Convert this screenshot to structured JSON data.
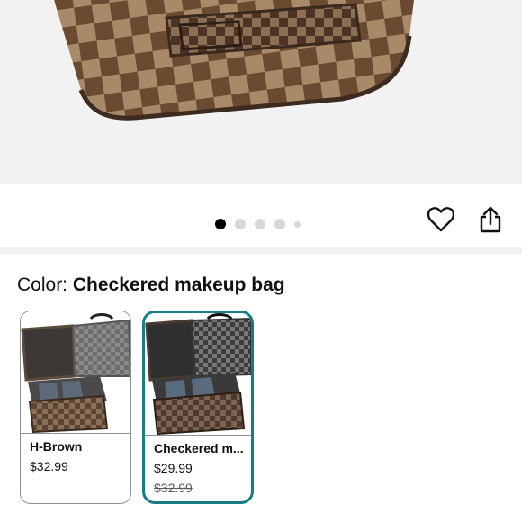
{
  "hero": {
    "image_alt": "checkered makeup bag close-up"
  },
  "pager": {
    "count": 5,
    "active_index": 0
  },
  "actions": {
    "favorite_icon": "heart-icon",
    "share_icon": "share-icon"
  },
  "color": {
    "label": "Color:",
    "selected_value": "Checkered makeup bag"
  },
  "swatches": [
    {
      "name": "H-Brown",
      "price": "$32.99",
      "list_price": "",
      "selected": false
    },
    {
      "name": "Checkered m...",
      "price": "$29.99",
      "list_price": "$32.99",
      "selected": true
    }
  ],
  "colors": {
    "accent": "#197b84",
    "brown": "#6b4a32",
    "tan": "#a88a68"
  }
}
